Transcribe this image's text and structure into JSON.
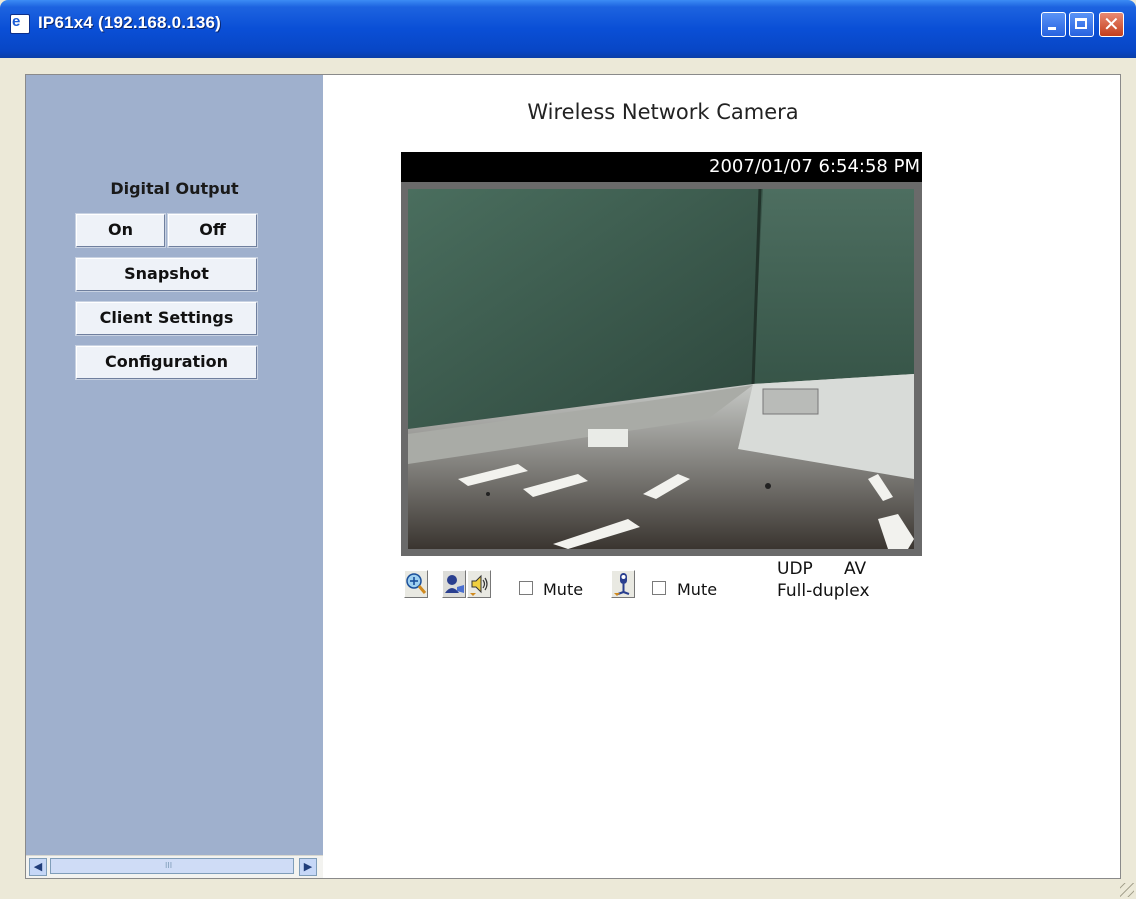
{
  "window": {
    "title": "IP61x4 (192.168.0.136)",
    "icon": "ie-page-icon"
  },
  "sidebar": {
    "digital_output_label": "Digital Output",
    "on_label": "On",
    "off_label": "Off",
    "snapshot_label": "Snapshot",
    "client_settings_label": "Client Settings",
    "configuration_label": "Configuration",
    "scrollbar_thumb_grip": "III"
  },
  "main": {
    "title": "Wireless Network Camera",
    "timestamp": "2007/01/07 6:54:58 PM",
    "controls": {
      "zoom_icon": "zoom-in-icon",
      "talk_icon": "talk-user-icon",
      "speaker_icon": "speaker-icon",
      "speaker_mute_label": "Mute",
      "speaker_mute_checked": false,
      "mic_icon": "microphone-icon",
      "mic_mute_label": "Mute",
      "mic_mute_checked": false
    },
    "status": {
      "protocol": "UDP",
      "media": "AV",
      "mode": "Full-duplex"
    }
  }
}
